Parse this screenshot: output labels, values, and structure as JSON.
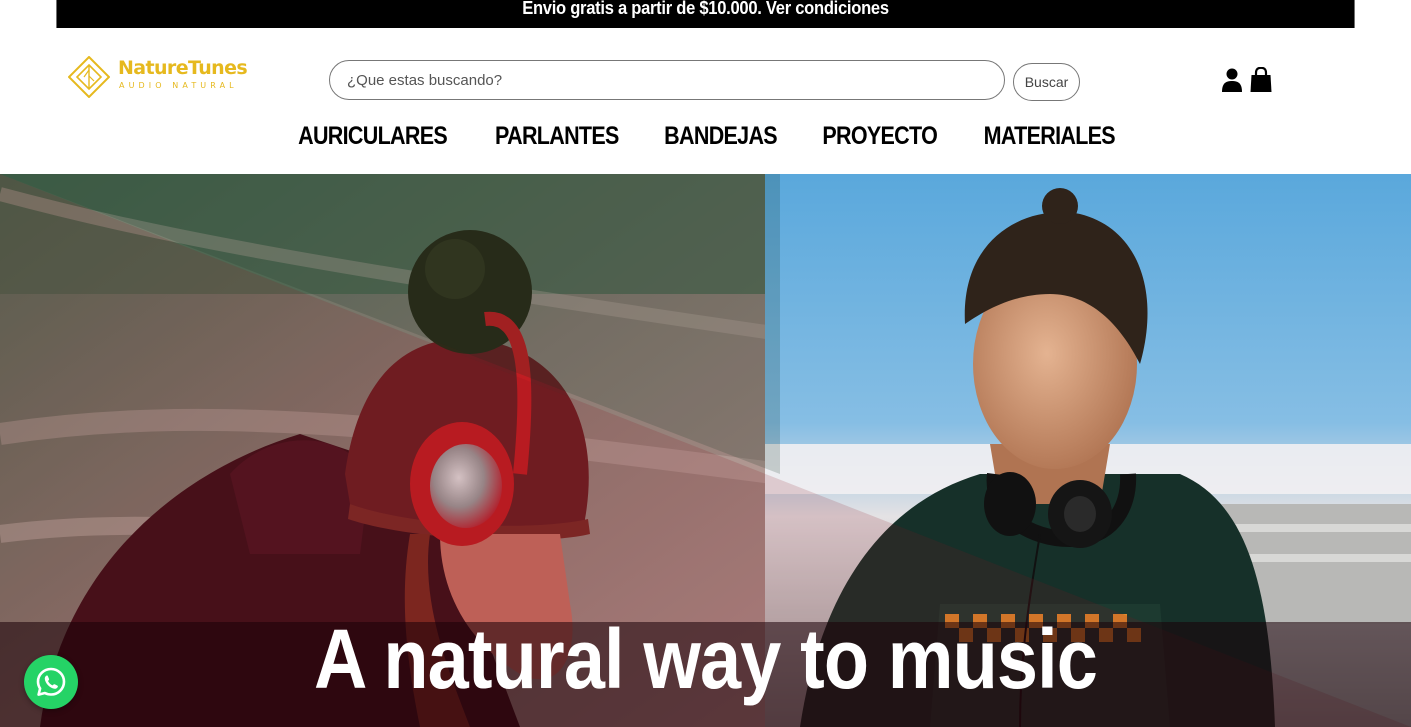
{
  "announcement": {
    "text": "Envio gratis a partir de $10.000. Ver condiciones"
  },
  "brand": {
    "name": "NatureTunes",
    "tagline": "AUDIO NATURAL",
    "color": "#e6b91e"
  },
  "search": {
    "placeholder": "¿Que estas buscando?",
    "value": "",
    "button_label": "Buscar"
  },
  "header_icons": [
    "user-icon",
    "shopping-bag-icon"
  ],
  "nav": {
    "items": [
      {
        "label": "AURICULARES"
      },
      {
        "label": "PARLANTES"
      },
      {
        "label": "BANDEJAS"
      },
      {
        "label": "PROYECTO"
      },
      {
        "label": "MATERIALES"
      }
    ]
  },
  "hero": {
    "headline": "A natural way to music"
  },
  "floating": {
    "icon": "whatsapp-icon",
    "color": "#25d366"
  }
}
